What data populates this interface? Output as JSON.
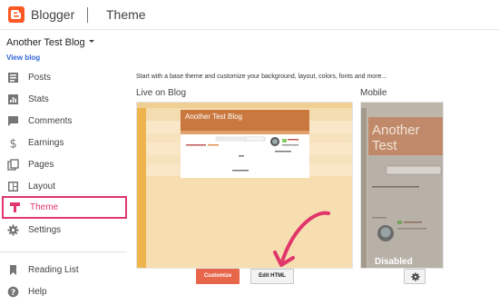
{
  "header": {
    "brand": "Blogger",
    "section": "Theme"
  },
  "blog_selector": {
    "name": "Another Test Blog",
    "view_blog": "View blog"
  },
  "nav": [
    {
      "label": "Posts",
      "icon": "posts-icon"
    },
    {
      "label": "Stats",
      "icon": "stats-icon"
    },
    {
      "label": "Comments",
      "icon": "comments-icon"
    },
    {
      "label": "Earnings",
      "icon": "dollar-icon"
    },
    {
      "label": "Pages",
      "icon": "pages-icon"
    },
    {
      "label": "Layout",
      "icon": "layout-icon"
    },
    {
      "label": "Theme",
      "icon": "theme-icon",
      "active": true
    },
    {
      "label": "Settings",
      "icon": "gear-icon"
    },
    {
      "label": "Reading List",
      "icon": "bookmark-icon"
    },
    {
      "label": "Help",
      "icon": "help-icon"
    }
  ],
  "main": {
    "intro": "Start with a base theme and customize your background, layout, colors, fonts and more...",
    "live": {
      "heading": "Live on Blog",
      "blog_title": "Another Test Blog"
    },
    "mobile": {
      "heading": "Mobile",
      "blog_title": "Another Test",
      "status": "Disabled"
    },
    "buttons": {
      "customize": "Customize",
      "edit_html": "Edit HTML"
    }
  },
  "colors": {
    "accent": "#ff5722",
    "active": "#e0366b",
    "customize": "#e8674a",
    "arrow": "#e0366b",
    "link": "#3367d6"
  }
}
